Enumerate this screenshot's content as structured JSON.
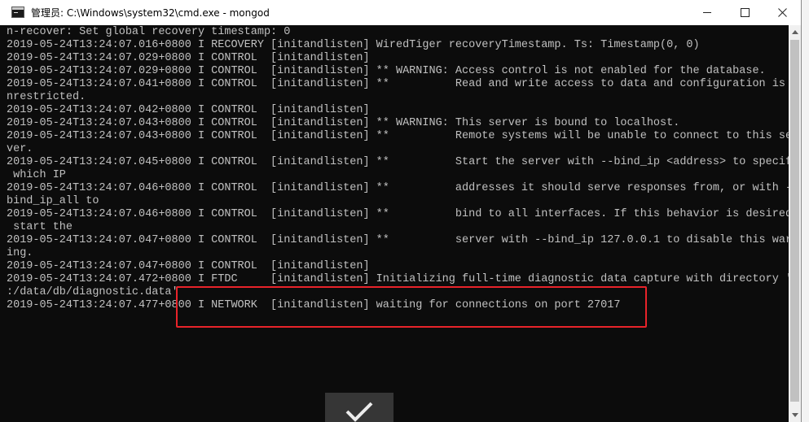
{
  "window": {
    "title": "管理员: C:\\Windows\\system32\\cmd.exe - mongod"
  },
  "console": {
    "lines": [
      "n-recover: Set global recovery timestamp: 0",
      "2019-05-24T13:24:07.016+0800 I RECOVERY [initandlisten] WiredTiger recoveryTimestamp. Ts: Timestamp(0, 0)",
      "2019-05-24T13:24:07.029+0800 I CONTROL  [initandlisten]",
      "2019-05-24T13:24:07.029+0800 I CONTROL  [initandlisten] ** WARNING: Access control is not enabled for the database.",
      "2019-05-24T13:24:07.041+0800 I CONTROL  [initandlisten] **          Read and write access to data and configuration is u",
      "nrestricted.",
      "2019-05-24T13:24:07.042+0800 I CONTROL  [initandlisten]",
      "2019-05-24T13:24:07.043+0800 I CONTROL  [initandlisten] ** WARNING: This server is bound to localhost.",
      "2019-05-24T13:24:07.043+0800 I CONTROL  [initandlisten] **          Remote systems will be unable to connect to this ser",
      "ver.",
      "2019-05-24T13:24:07.045+0800 I CONTROL  [initandlisten] **          Start the server with --bind_ip <address> to specify",
      " which IP",
      "2019-05-24T13:24:07.046+0800 I CONTROL  [initandlisten] **          addresses it should serve responses from, or with --",
      "bind_ip_all to",
      "2019-05-24T13:24:07.046+0800 I CONTROL  [initandlisten] **          bind to all interfaces. If this behavior is desired,",
      " start the",
      "2019-05-24T13:24:07.047+0800 I CONTROL  [initandlisten] **          server with --bind_ip 127.0.0.1 to disable this warn",
      "ing.",
      "2019-05-24T13:24:07.047+0800 I CONTROL  [initandlisten]",
      "2019-05-24T13:24:07.472+0800 I FTDC     [initandlisten] Initializing full-time diagnostic data capture with directory 'C",
      ":/data/db/diagnostic.data'",
      "2019-05-24T13:24:07.477+0800 I NETWORK  [initandlisten] waiting for connections on port 27017"
    ]
  },
  "annotation": {
    "highlight_color": "#e8232a"
  },
  "icons": {
    "app": "cmd-console-icon",
    "minimize": "minimize-icon",
    "maximize": "maximize-icon",
    "close": "close-icon",
    "check": "checkmark-icon",
    "scroll_up": "chevron-up-icon",
    "scroll_down": "chevron-down-icon"
  }
}
